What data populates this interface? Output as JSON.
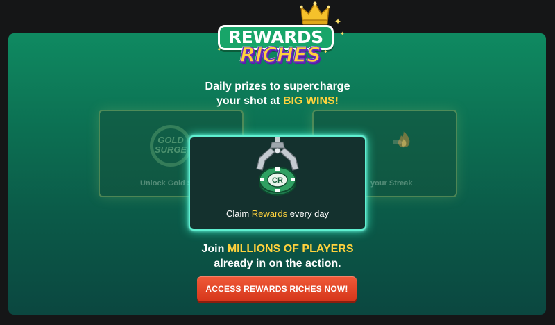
{
  "logo": {
    "line1": "REWARDS",
    "line2": "RICHES",
    "icon": "crown-icon"
  },
  "tagline": {
    "line1": "Daily prizes to supercharge",
    "line2_prefix": "your shot at ",
    "line2_highlight": "BIG WINS!"
  },
  "cards": {
    "left": {
      "badge_line1": "GOLD",
      "badge_line2": "SURGE",
      "label": "Unlock Gold S",
      "icon": "gold-surge-badge-icon"
    },
    "center": {
      "caption_prefix": "Claim ",
      "caption_highlight": "Rewards",
      "caption_suffix": " every day",
      "chip_text": "CR",
      "icon": "claw-chip-icon"
    },
    "right": {
      "label": "your Streak",
      "icon": "flame-icon"
    }
  },
  "join": {
    "prefix": "Join ",
    "highlight": "MILLIONS OF PLAYERS",
    "line2": "already in on the action."
  },
  "cta": {
    "label": "ACCESS REWARDS RICHES NOW!"
  },
  "colors": {
    "accent": "#ffd23d",
    "cta": "#e2482a",
    "glow": "#5ff0d0",
    "panel": "#0f8a61"
  }
}
